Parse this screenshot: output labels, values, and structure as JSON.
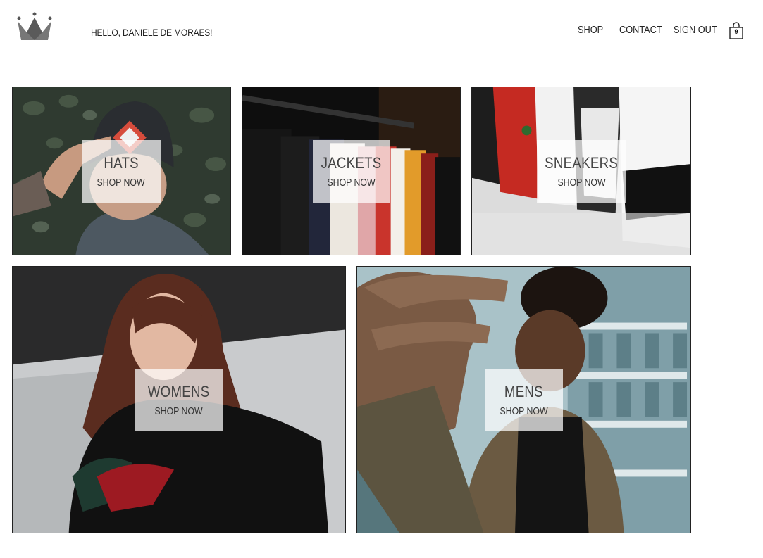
{
  "header": {
    "greeting": "HELLO, DANIELE DE MORAES!",
    "logo_icon": "crown-icon",
    "nav": [
      {
        "label": "SHOP",
        "icon": null
      },
      {
        "label": "CONTACT",
        "icon": null
      },
      {
        "label": "SIGN OUT",
        "icon": null
      }
    ],
    "cart": {
      "icon": "shopping-bag-icon",
      "count": "9"
    }
  },
  "categories": [
    {
      "title": "HATS",
      "cta": "SHOP NOW"
    },
    {
      "title": "JACKETS",
      "cta": "SHOP NOW"
    },
    {
      "title": "SNEAKERS",
      "cta": "SHOP NOW"
    },
    {
      "title": "WOMENS",
      "cta": "SHOP NOW"
    },
    {
      "title": "MENS",
      "cta": "SHOP NOW"
    }
  ],
  "colors": {
    "border": "#222222",
    "label_overlay": "rgba(255,255,255,0.72)",
    "text": "#444444"
  }
}
